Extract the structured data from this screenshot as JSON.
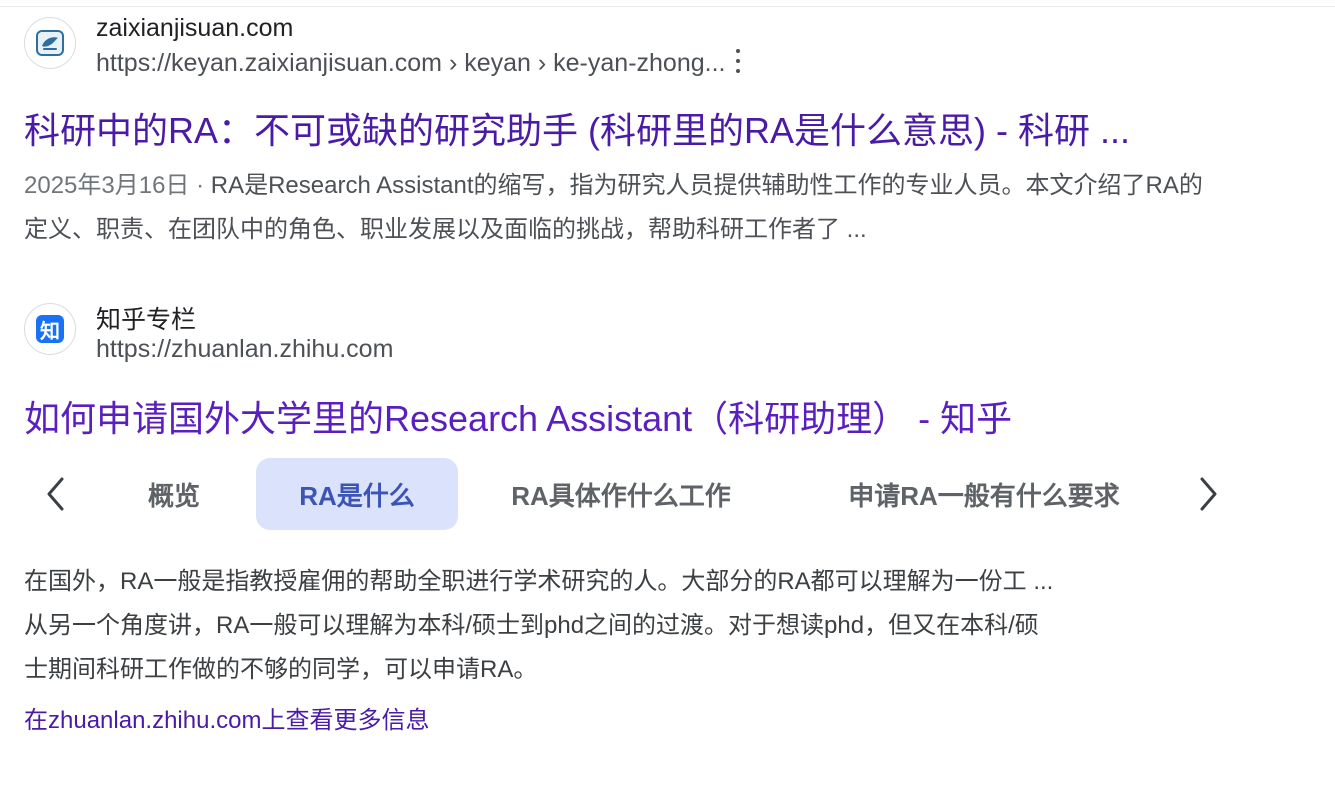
{
  "results": [
    {
      "site_name": "zaixianjisuan.com",
      "url": "https://keyan.zaixianjisuan.com › keyan › ke-yan-zhong...",
      "icon": "bird-logo-icon",
      "title": "科研中的RA：不可或缺的研究助手 (科研里的RA是什么意思) - 科研 ...",
      "date": "2025年3月16日 · ",
      "snippet": "RA是Research Assistant的缩写，指为研究人员提供辅助性工作的专业人员。本文介绍了RA的定义、职责、在团队中的角色、职业发展以及面临的挑战，帮助科研工作者了 ..."
    },
    {
      "site_name": "知乎专栏",
      "url": "https://zhuanlan.zhihu.com",
      "icon_text": "知",
      "title": "如何申请国外大学里的Research Assistant（科研助理） - 知乎"
    }
  ],
  "chips": {
    "items": [
      "概览",
      "RA是什么",
      "RA具体作什么工作",
      "申请RA一般有什么要求"
    ],
    "active_index": 1
  },
  "body": {
    "lines": [
      "在国外，RA一般是指教授雇佣的帮助全职进行学术研究的人。大部分的RA都可以理解为一份工 ...",
      "从另一个角度讲，RA一般可以理解为本科/硕士到phd之间的过渡。对于想读phd，但又在本科/硕",
      "士期间科研工作做的不够的同学，可以申请RA。"
    ]
  },
  "more_link": "在zhuanlan.zhihu.com上查看更多信息",
  "colors": {
    "link": "#4a1ba6",
    "active_chip_bg": "#dbe2fb",
    "active_chip_text": "#3c54b4",
    "zhihu_blue": "#1772f6"
  }
}
